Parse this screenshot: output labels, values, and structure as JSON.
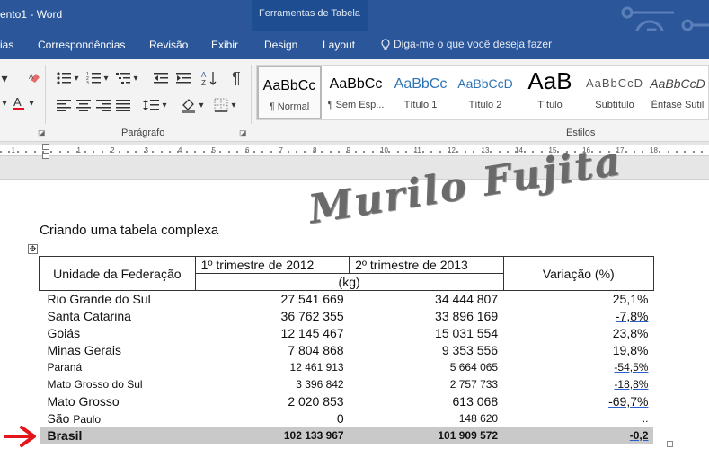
{
  "window": {
    "title": "ento1 - Word",
    "context_group": "Ferramentas de Tabela"
  },
  "tabs": [
    {
      "label": "ias"
    },
    {
      "label": "Correspondências"
    },
    {
      "label": "Revisão"
    },
    {
      "label": "Exibir"
    },
    {
      "label": "Design"
    },
    {
      "label": "Layout"
    }
  ],
  "tell_me": "Diga-me o que você deseja fazer",
  "ribbon": {
    "paragraph_label": "Parágrafo",
    "styles_label": "Estilos",
    "styles": [
      {
        "preview": "AaBbCc",
        "name": "¶ Normal"
      },
      {
        "preview": "AaBbCc",
        "name": "¶ Sem Esp..."
      },
      {
        "preview": "AaBbCc",
        "name": "Título 1"
      },
      {
        "preview": "AaBbCcD",
        "name": "Título 2"
      },
      {
        "preview": "AaB",
        "name": "Título"
      },
      {
        "preview": "AaBbCcD",
        "name": "Subtítulo"
      },
      {
        "preview": "AaBbCcD",
        "name": "Ênfase Sutil"
      }
    ],
    "font_color": "#e81123",
    "accent": "#2b579a"
  },
  "ruler": [
    "4",
    "3",
    "2",
    "1",
    "1",
    "2",
    "3",
    "4",
    "5",
    "6",
    "7",
    "8",
    "9",
    "10",
    "11",
    "12",
    "13",
    "14",
    "15",
    "16",
    "17",
    "18"
  ],
  "document": {
    "heading": "Criando uma tabela complexa",
    "watermark": "Murilo Fujita",
    "table": {
      "header": {
        "col1": "Unidade da Federação",
        "col2": "1º trimestre de 2012",
        "col3": "2º trimestre de 2013",
        "col4": "Variação (%)",
        "unit": "(kg)"
      },
      "rows": [
        {
          "uf": "Rio Grande do Sul",
          "v2012": "27 541 669",
          "v2013": "34 444 807",
          "var": "25,1%"
        },
        {
          "uf": "Santa Catarina",
          "v2012": "36 762 355",
          "v2013": "33 896 169",
          "var": "-7,8%"
        },
        {
          "uf": "Goiás",
          "v2012": "12 145 467",
          "v2013": "15 031 554",
          "var": "23,8%"
        },
        {
          "uf": "Minas Gerais",
          "v2012": "7 804 868",
          "v2013": "9 353 556",
          "var": "19,8%"
        },
        {
          "uf": "Paraná",
          "v2012": "12 461 913",
          "v2013": "5 664 065",
          "var": "-54,5%"
        },
        {
          "uf": "Mato Grosso do Sul",
          "v2012": "3 396 842",
          "v2013": "2 757 733",
          "var": "-18,8%"
        },
        {
          "uf": "Mato Grosso",
          "v2012": "2 020 853",
          "v2013": "613 068",
          "var": "-69,7%"
        },
        {
          "uf_a": "São",
          "uf_b": "Paulo",
          "v2012": "0",
          "v2013": "148 620",
          "var": ".."
        }
      ],
      "total": {
        "uf": "Brasil",
        "v2012": "102 133 967",
        "v2013": "101 909 572",
        "var": "-0,2"
      }
    }
  },
  "arrow_color": "#e3161b"
}
